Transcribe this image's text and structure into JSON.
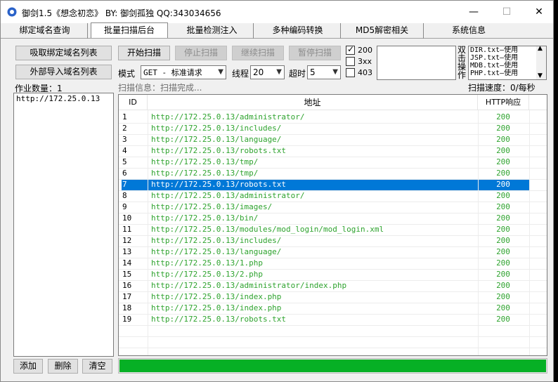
{
  "window": {
    "title": "御剑1.5《想念初恋》 BY: 御剑孤独 QQ:343034656",
    "controls": {
      "minimize": "—",
      "maximize": "☐",
      "close": "✕"
    }
  },
  "tabs": [
    {
      "label": "绑定域名查询"
    },
    {
      "label": "批量扫描后台"
    },
    {
      "label": "批量检测注入"
    },
    {
      "label": "多种编码转换"
    },
    {
      "label": "MD5解密相关"
    },
    {
      "label": "系统信息"
    }
  ],
  "left": {
    "fetch_label": "吸取绑定域名列表",
    "import_label": "外部导入域名列表",
    "job_count_label": "作业数量：1",
    "targets": [
      "http://172.25.0.13"
    ],
    "add_label": "添加",
    "delete_label": "删除",
    "clear_label": "清空"
  },
  "controls": {
    "start": "开始扫描",
    "stop": "停止扫描",
    "resume": "继续扫描",
    "pause": "暂停扫描",
    "mode_label": "模式",
    "mode_value": "GET - 标准请求",
    "threads_label": "线程",
    "threads_value": "20",
    "timeout_label": "超时",
    "timeout_value": "5",
    "status_200": "200",
    "status_3xx": "3xx",
    "status_403": "403",
    "dbl_click_label": [
      "双",
      "击",
      "操",
      "作"
    ],
    "dicts": [
      "DIR.txt—使用",
      "JSP.txt—使用",
      "MDB.txt—使用",
      "PHP.txt—使用"
    ]
  },
  "scan": {
    "info": "扫描信息：扫描完成...",
    "speed": "扫描速度：0/每秒",
    "progress": 1.0
  },
  "table": {
    "headers": {
      "id": "ID",
      "url": "地址",
      "code": "HTTP响应"
    },
    "selected_row": 7,
    "rows": [
      {
        "id": "1",
        "url": "http://172.25.0.13/administrator/",
        "code": "200"
      },
      {
        "id": "2",
        "url": "http://172.25.0.13/includes/",
        "code": "200"
      },
      {
        "id": "3",
        "url": "http://172.25.0.13/language/",
        "code": "200"
      },
      {
        "id": "4",
        "url": "http://172.25.0.13/robots.txt",
        "code": "200"
      },
      {
        "id": "5",
        "url": "http://172.25.0.13/tmp/",
        "code": "200"
      },
      {
        "id": "6",
        "url": "http://172.25.0.13/tmp/",
        "code": "200"
      },
      {
        "id": "7",
        "url": "http://172.25.0.13/robots.txt",
        "code": "200"
      },
      {
        "id": "8",
        "url": "http://172.25.0.13/administrator/",
        "code": "200"
      },
      {
        "id": "9",
        "url": "http://172.25.0.13/images/",
        "code": "200"
      },
      {
        "id": "10",
        "url": "http://172.25.0.13/bin/",
        "code": "200"
      },
      {
        "id": "11",
        "url": "http://172.25.0.13/modules/mod_login/mod_login.xml",
        "code": "200"
      },
      {
        "id": "12",
        "url": "http://172.25.0.13/includes/",
        "code": "200"
      },
      {
        "id": "13",
        "url": "http://172.25.0.13/language/",
        "code": "200"
      },
      {
        "id": "14",
        "url": "http://172.25.0.13/1.php",
        "code": "200"
      },
      {
        "id": "15",
        "url": "http://172.25.0.13/2.php",
        "code": "200"
      },
      {
        "id": "16",
        "url": "http://172.25.0.13/administrator/index.php",
        "code": "200"
      },
      {
        "id": "17",
        "url": "http://172.25.0.13/index.php",
        "code": "200"
      },
      {
        "id": "18",
        "url": "http://172.25.0.13/index.php",
        "code": "200"
      },
      {
        "id": "19",
        "url": "http://172.25.0.13/robots.txt",
        "code": "200"
      }
    ]
  },
  "colors": {
    "url_text": "#2ea32e",
    "selection": "#0078d7",
    "progress": "#06b025"
  }
}
